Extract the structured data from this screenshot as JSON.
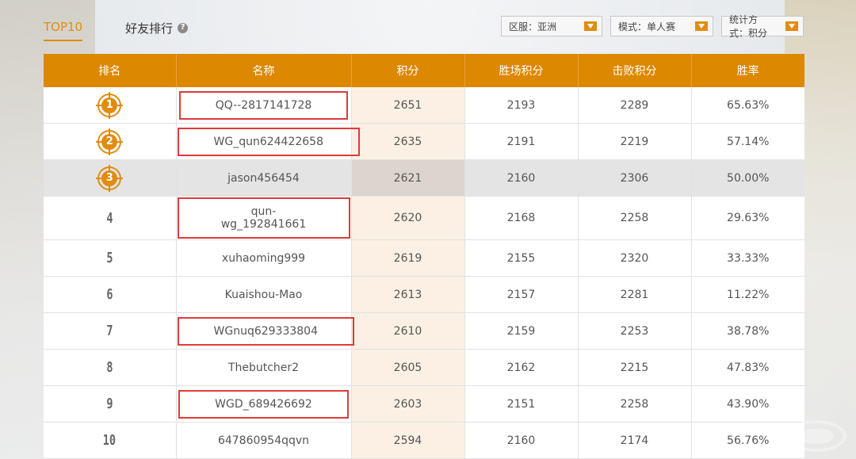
{
  "tabs": [
    {
      "label": "TOP10",
      "active": true
    },
    {
      "label": "好友排行",
      "active": false
    }
  ],
  "filters": [
    {
      "label": "区服：亚洲"
    },
    {
      "label": "模式：单人赛"
    },
    {
      "label": "统计方式：积分"
    }
  ],
  "columns": [
    "排名",
    "名称",
    "积分",
    "胜场积分",
    "击败积分",
    "胜率"
  ],
  "rows": [
    {
      "rank": "1",
      "name": "QQ--2817141728",
      "score": "2651",
      "win_score": "2193",
      "kill_score": "2289",
      "win_rate": "65.63%"
    },
    {
      "rank": "2",
      "name": "WG_qun624422658",
      "score": "2635",
      "win_score": "2191",
      "kill_score": "2219",
      "win_rate": "57.14%"
    },
    {
      "rank": "3",
      "name": "jason456454",
      "score": "2621",
      "win_score": "2160",
      "kill_score": "2306",
      "win_rate": "50.00%"
    },
    {
      "rank": "4",
      "name": "qun-wg_192841661",
      "score": "2620",
      "win_score": "2168",
      "kill_score": "2258",
      "win_rate": "29.63%"
    },
    {
      "rank": "5",
      "name": "xuhaoming999",
      "score": "2619",
      "win_score": "2155",
      "kill_score": "2320",
      "win_rate": "33.33%"
    },
    {
      "rank": "6",
      "name": "Kuaishou-Mao",
      "score": "2613",
      "win_score": "2157",
      "kill_score": "2281",
      "win_rate": "11.22%"
    },
    {
      "rank": "7",
      "name": "WGnuq629333804",
      "score": "2610",
      "win_score": "2159",
      "kill_score": "2253",
      "win_rate": "38.78%"
    },
    {
      "rank": "8",
      "name": "Thebutcher2",
      "score": "2605",
      "win_score": "2162",
      "kill_score": "2215",
      "win_rate": "47.83%"
    },
    {
      "rank": "9",
      "name": "WGD_689426692",
      "score": "2603",
      "win_score": "2151",
      "kill_score": "2258",
      "win_rate": "43.90%"
    },
    {
      "rank": "10",
      "name": "647860954qqvn",
      "score": "2594",
      "win_score": "2160",
      "kill_score": "2174",
      "win_rate": "56.76%"
    }
  ],
  "colors": {
    "accent": "#dc8800",
    "highlight_box": "#e03a3a"
  },
  "icons": {
    "help": "help-icon",
    "dropdown": "chevron-down-icon",
    "medal": "medal-icon"
  }
}
